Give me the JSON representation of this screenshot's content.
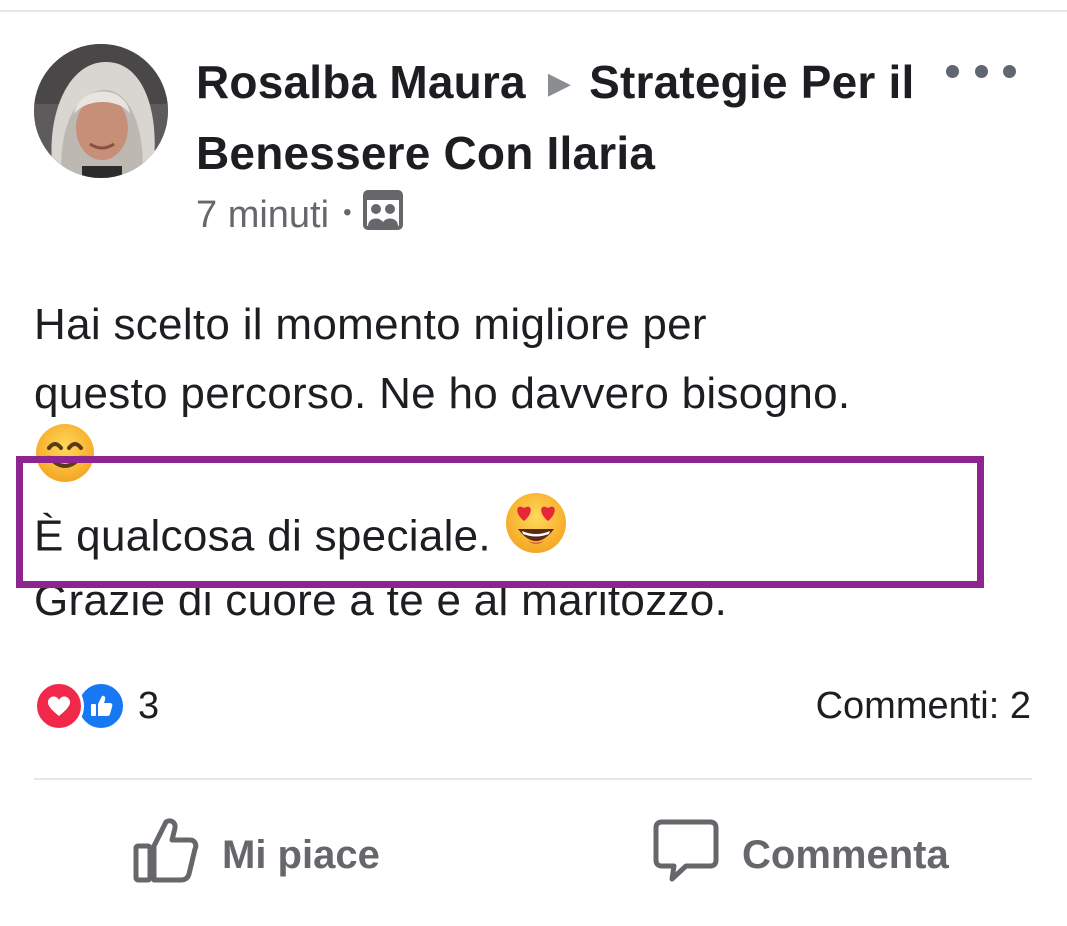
{
  "post": {
    "author": "Rosalba Maura",
    "group": "Strategie Per il Benessere Con Ilaria",
    "time": "7 minuti",
    "audience_icon": "group-members-icon",
    "more_icon": "more-options-icon",
    "text_lines": [
      "Hai scelto il momento migliore per",
      "questo percorso. Ne ho davvero bisogno.",
      "",
      "È qualcosa di speciale.",
      "Grazie di cuore a te e al maritozzo."
    ],
    "emojis": [
      "smiling-face-emoji",
      "heart-eyes-emoji"
    ],
    "highlight_color": "#8e2490"
  },
  "reactions": {
    "icons": [
      "love-reaction-icon",
      "like-reaction-icon"
    ],
    "count": "3",
    "comments": "Commenti: 2"
  },
  "actions": {
    "like_label": "Mi piace",
    "comment_label": "Commenta"
  },
  "colors": {
    "text": "#1c1e21",
    "secondary": "#65676b",
    "love": "#f0284a",
    "like": "#1877f2"
  }
}
